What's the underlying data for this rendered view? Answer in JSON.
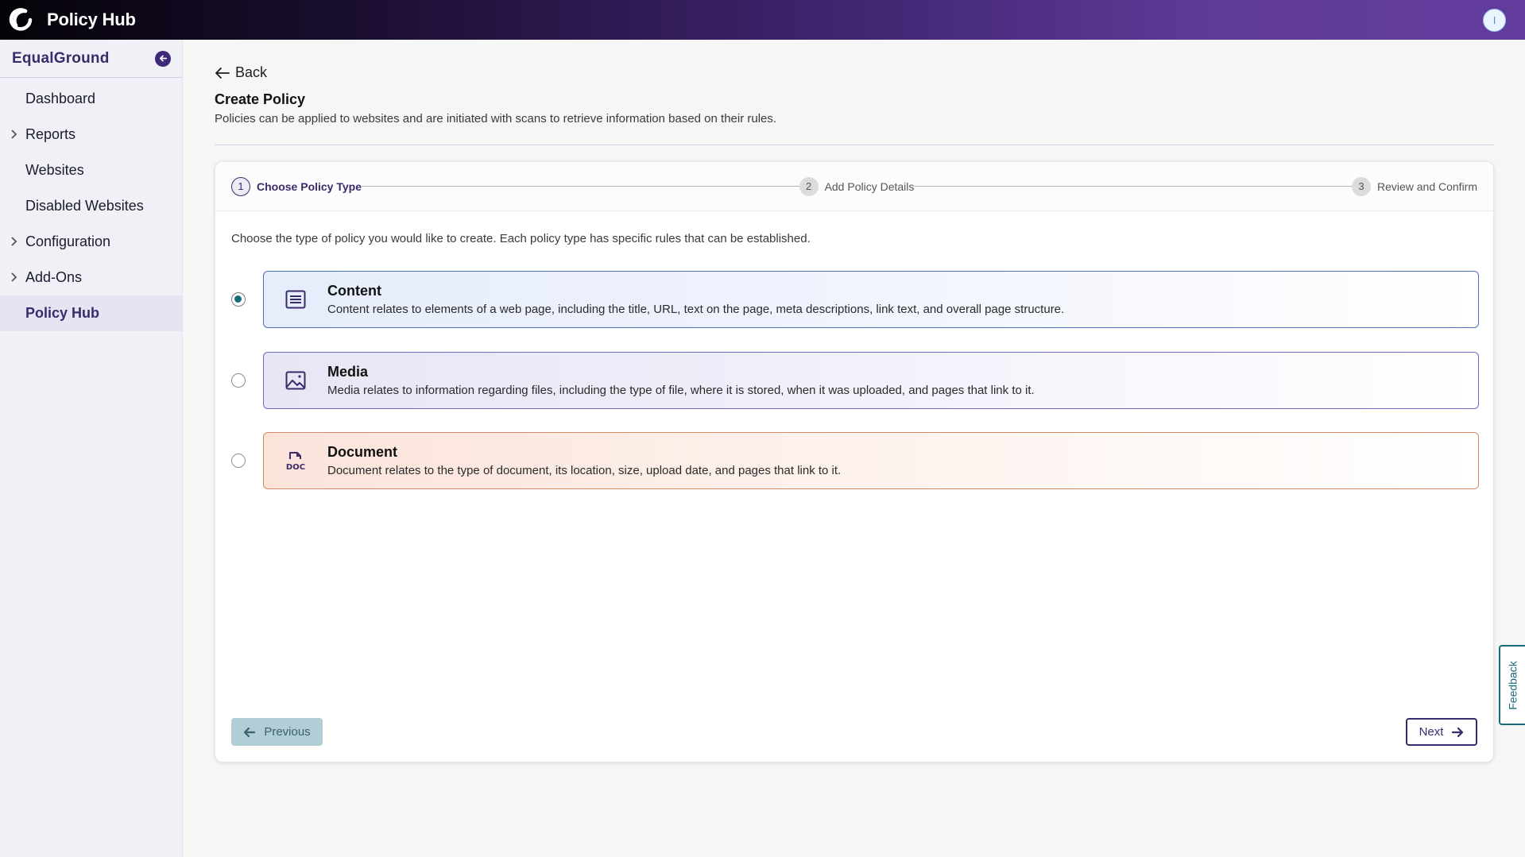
{
  "app": {
    "title": "Policy Hub",
    "logo_icon": "brand-swirl-logo",
    "user_avatar_initial": "I",
    "accent_color": "#3b2b6b",
    "header_gradient_end": "#623c9c"
  },
  "sidebar": {
    "org_name": "EqualGround",
    "collapse_icon": "arrow-left-circle-icon",
    "items": [
      {
        "label": "Dashboard",
        "expandable": false,
        "active": false
      },
      {
        "label": "Reports",
        "expandable": true,
        "active": false
      },
      {
        "label": "Websites",
        "expandable": false,
        "active": false
      },
      {
        "label": "Disabled Websites",
        "expandable": false,
        "active": false
      },
      {
        "label": "Configuration",
        "expandable": true,
        "active": false
      },
      {
        "label": "Add-Ons",
        "expandable": true,
        "active": false
      },
      {
        "label": "Policy Hub",
        "expandable": false,
        "active": true
      }
    ]
  },
  "page": {
    "back_label": "Back",
    "title": "Create Policy",
    "subtitle": "Policies can be applied to websites and are initiated with scans to retrieve information based on their rules."
  },
  "stepper": {
    "steps": [
      {
        "number": "1",
        "label": "Choose Policy Type",
        "state": "active"
      },
      {
        "number": "2",
        "label": "Add Policy Details",
        "state": "inactive"
      },
      {
        "number": "3",
        "label": "Review and Confirm",
        "state": "inactive"
      }
    ]
  },
  "wizard": {
    "intro": "Choose the type of policy you would like to create. Each policy type has specific rules that can be established.",
    "selected": "content",
    "options": [
      {
        "id": "content",
        "title": "Content",
        "icon": "content-lines-icon",
        "description": "Content relates to elements of a web page, including the title, URL, text on the page, meta descriptions, link text, and overall page structure.",
        "border_color": "#4f6fb8"
      },
      {
        "id": "media",
        "title": "Media",
        "icon": "image-icon",
        "description": "Media relates to information regarding files, including the type of file, where it is stored, when it was uploaded, and pages that link to it.",
        "border_color": "#6a6ac0"
      },
      {
        "id": "document",
        "title": "Document",
        "icon": "doc-file-icon",
        "icon_text": "DOC",
        "description": "Document relates to the type of document, its location, size, upload date, and pages that link to it.",
        "border_color": "#d08a6a"
      }
    ],
    "previous_label": "Previous",
    "next_label": "Next"
  },
  "feedback": {
    "label": "Feedback"
  }
}
